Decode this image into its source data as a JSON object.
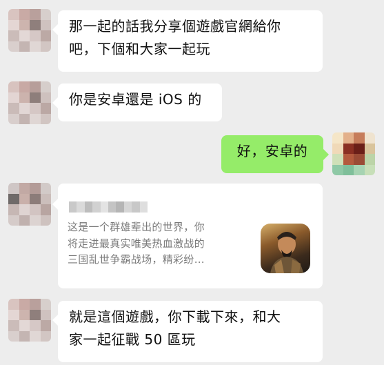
{
  "messages": [
    {
      "side": "left",
      "lines": [
        "那一起的話我分享個遊戲官網給你",
        "吧，下個和大家一起玩"
      ]
    },
    {
      "side": "left",
      "lines": [
        "你是安卓還是 iOS 的"
      ]
    },
    {
      "side": "right",
      "lines": [
        "好，安卓的"
      ]
    },
    {
      "side": "left",
      "type": "link-card",
      "description": [
        "这是一个群雄辈出的世界，你",
        "将走进最真实唯美热血激战的",
        "三国乱世争霸战场，精彩纷…"
      ]
    },
    {
      "side": "left",
      "lines": [
        "就是這個遊戲，你下載下來，和大",
        "家一起征戰 50 區玩"
      ]
    }
  ],
  "colors": {
    "background": "#ededed",
    "incoming_bubble": "#ffffff",
    "outgoing_bubble": "#95ec69",
    "link_description": "#7a7a7a"
  },
  "icons": [
    "blurred-avatar-icon",
    "game-thumbnail-icon"
  ]
}
